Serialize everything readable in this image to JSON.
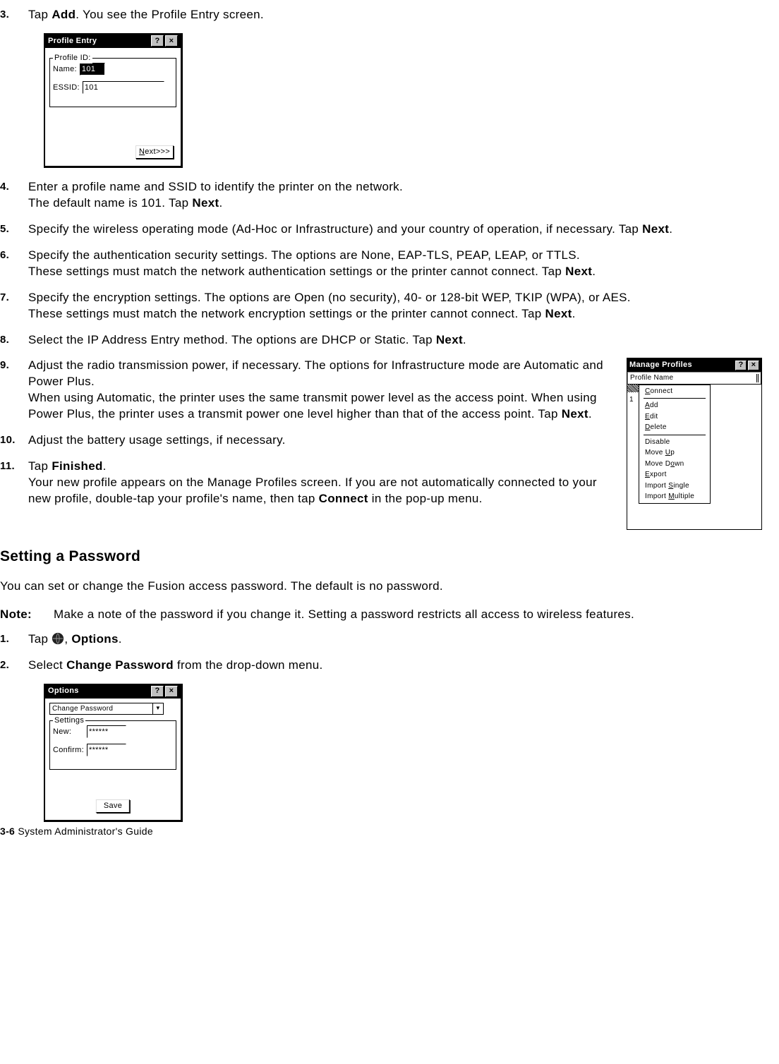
{
  "steps": {
    "s3": {
      "num": "3.",
      "pre": "Tap ",
      "bold": "Add",
      "post": ". You see the Profile Entry screen."
    },
    "s4": {
      "num": "4.",
      "l1": "Enter a profile name and SSID to identify the printer on the network.",
      "l2a": "The default name is 101. Tap ",
      "l2b": "Next",
      "l2c": "."
    },
    "s5": {
      "num": "5.",
      "l1a": "Specify the wireless operating mode (Ad-Hoc or Infrastructure) and your country of operation, if necessary. Tap ",
      "l1b": "Next",
      "l1c": "."
    },
    "s6": {
      "num": "6.",
      "l1": "Specify the authentication security settings. The options are None, EAP-TLS, PEAP, LEAP, or TTLS.",
      "l2a": "These settings must match the network authentication settings or the printer cannot connect. Tap ",
      "l2b": "Next",
      "l2c": "."
    },
    "s7": {
      "num": "7.",
      "l1": "Specify the encryption settings. The options are Open (no security), 40- or 128-bit WEP, TKIP (WPA), or AES.",
      "l2a": "These settings must match the network encryption settings or the printer cannot connect. Tap ",
      "l2b": "Next",
      "l2c": "."
    },
    "s8": {
      "num": "8.",
      "l1a": "Select the IP Address Entry method. The options are DHCP or Static. Tap ",
      "l1b": "Next",
      "l1c": "."
    },
    "s9": {
      "num": "9.",
      "l1": "Adjust the radio transmission power, if necessary. The options for Infrastructure mode are Automatic and Power Plus.",
      "l2a": "When using Automatic, the printer uses the same transmit power level as the access point. When using Power Plus, the printer uses a transmit power one level higher than that of the access point. Tap ",
      "l2b": "Next",
      "l2c": "."
    },
    "s10": {
      "num": "10.",
      "l1": "Adjust the battery usage settings, if necessary."
    },
    "s11": {
      "num": "11.",
      "l1a": "Tap ",
      "l1b": "Finished",
      "l1c": ".",
      "l2a": "Your new profile appears on the Manage Profiles screen. If you are not automatically connected to your new profile, double-tap your profile's name, then tap ",
      "l2b": "Connect",
      "l2c": " in the pop-up menu."
    }
  },
  "profileEntry": {
    "title": "Profile Entry",
    "legend": "Profile ID:",
    "nameLabel": "Name:",
    "nameValue": "101",
    "essidLabel": "ESSID:",
    "essidValue": "101",
    "next": "ext>>>",
    "nextU": "N"
  },
  "manageProfiles": {
    "title": "Manage Profiles",
    "header": "Profile Name",
    "row": "1",
    "menu": {
      "connect": "onnect",
      "connectU": "C",
      "add": "dd",
      "addU": "A",
      "edit": "dit",
      "editU": "E",
      "delete": "elete",
      "deleteU": "D",
      "disable": "isable",
      "disablePre": "D",
      "moveUp": "Move ",
      "moveUpU": "U",
      "moveUpPost": "p",
      "moveDown": "Move D",
      "moveDownU": "o",
      "moveDownPost": "wn",
      "export": "xport",
      "exportU": "E",
      "importS": "Import ",
      "importSU": "S",
      "importSPost": "ingle",
      "importM": "Import ",
      "importMU": "M",
      "importMPost": "ultiple"
    }
  },
  "section1": {
    "title": "Setting a Password",
    "p1": "You can set or change the Fusion access password. The default is no password."
  },
  "note": {
    "label": "Note:",
    "text": "Make a note of the password if you change it. Setting a password restricts all access to wireless features."
  },
  "pw": {
    "s1": {
      "num": "1.",
      "pre": "Tap ",
      "post": ", ",
      "bold": "Options",
      "end": "."
    },
    "s2": {
      "num": "2.",
      "pre": "Select ",
      "bold": "Change Password",
      "post": " from the drop-down menu."
    }
  },
  "options": {
    "title": "Options",
    "combo": "Change Password",
    "legend": "Settings",
    "newLabel": "New:",
    "confirmLabel": "Confirm:",
    "maskValue": "******",
    "saveU": "S",
    "save": "ave"
  },
  "footer": {
    "page": "3-6",
    "title": "  System Administrator's Guide"
  }
}
